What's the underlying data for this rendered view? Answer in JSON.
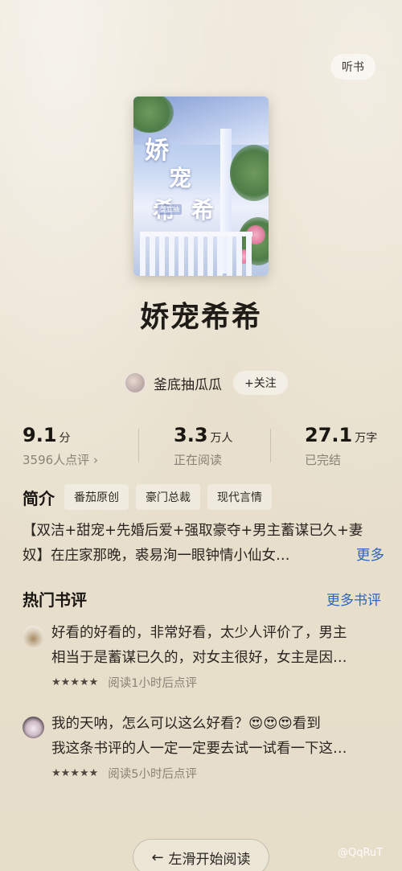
{
  "header": {
    "listen_label": "听书"
  },
  "cover": {
    "title_chars": [
      "娇",
      "宠",
      "希",
      "希"
    ],
    "author_tag": "釜底抽"
  },
  "book": {
    "title": "娇宠希希"
  },
  "author": {
    "name": "釜底抽瓜瓜",
    "follow_label": "+关注"
  },
  "stats": [
    {
      "value": "9.1",
      "unit": "分",
      "sub": "3596人点评 ›"
    },
    {
      "value": "3.3",
      "unit": "万人",
      "sub": "正在阅读"
    },
    {
      "value": "27.1",
      "unit": "万字",
      "sub": "已完结"
    }
  ],
  "intro": {
    "label": "简介",
    "tags": [
      "番茄原创",
      "豪门总裁",
      "现代言情"
    ],
    "line1": "【双洁+甜宠+先婚后爱+强取豪夺+男主蓄谋已久+妻",
    "line2": "奴】在庄家那晚，裘易洵一眼钟情小仙女…",
    "more": "更多"
  },
  "reviews_section": {
    "title": "热门书评",
    "more": "更多书评"
  },
  "reviews": [
    {
      "line1": "好看的好看的，非常好看，太少人评价了，男主",
      "line2": "相当于是蓄谋已久的，对女主很好，女主是因…",
      "stars": "★★★★★",
      "meta": "阅读1小时后点评"
    },
    {
      "line1": "我的天呐，怎么可以这么好看？😍😍😍看到",
      "line2": "我这条书评的人一定一定要去试一试看一下这…",
      "stars": "★★★★★",
      "meta": "阅读5小时后点评"
    }
  ],
  "bottom": {
    "arrow": "←",
    "label": "左滑开始阅读"
  },
  "watermark": "@QqRuT",
  "colors": {
    "accent_link": "#2f63c0",
    "background": "#e9e1cf"
  }
}
